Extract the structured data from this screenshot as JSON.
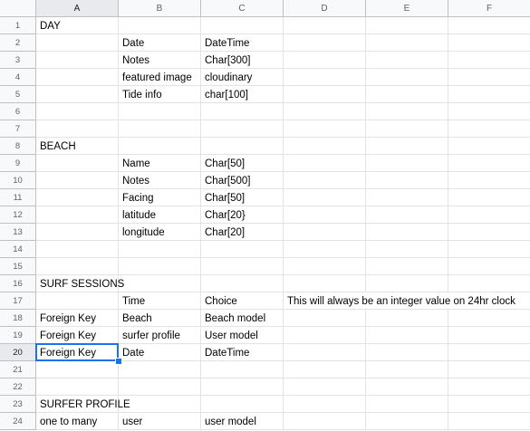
{
  "columns": [
    "A",
    "B",
    "C",
    "D",
    "E",
    "F"
  ],
  "selected_cell": "A20",
  "rows": [
    {
      "num": "1",
      "cells": [
        "DAY",
        "",
        ""
      ]
    },
    {
      "num": "2",
      "cells": [
        "",
        "Date",
        "DateTime"
      ]
    },
    {
      "num": "3",
      "cells": [
        "",
        "Notes",
        "Char[300]"
      ]
    },
    {
      "num": "4",
      "cells": [
        "",
        "featured image",
        "cloudinary"
      ]
    },
    {
      "num": "5",
      "cells": [
        "",
        "Tide info",
        "char[100]"
      ]
    },
    {
      "num": "6",
      "cells": [
        "",
        "",
        ""
      ]
    },
    {
      "num": "7",
      "cells": [
        "",
        "",
        ""
      ]
    },
    {
      "num": "8",
      "cells": [
        "BEACH",
        "",
        ""
      ]
    },
    {
      "num": "9",
      "cells": [
        "",
        "Name",
        "Char[50]"
      ]
    },
    {
      "num": "10",
      "cells": [
        "",
        "Notes",
        "Char[500]"
      ]
    },
    {
      "num": "11",
      "cells": [
        "",
        "Facing",
        "Char[50]"
      ]
    },
    {
      "num": "12",
      "cells": [
        "",
        "latitude",
        "Char[20}"
      ]
    },
    {
      "num": "13",
      "cells": [
        "",
        "longitude",
        "Char[20]"
      ]
    },
    {
      "num": "14",
      "cells": [
        "",
        "",
        ""
      ]
    },
    {
      "num": "15",
      "cells": [
        "",
        "",
        ""
      ]
    },
    {
      "num": "16",
      "cells": [
        "SURF SESSIONS",
        "",
        ""
      ]
    },
    {
      "num": "17",
      "cells": [
        "",
        "Time",
        "Choice",
        "This will always be an integer value on 24hr clock"
      ]
    },
    {
      "num": "18",
      "cells": [
        "Foreign Key",
        "Beach",
        "Beach model"
      ]
    },
    {
      "num": "19",
      "cells": [
        "Foreign Key",
        "surfer profile",
        "User model"
      ]
    },
    {
      "num": "20",
      "cells": [
        "Foreign Key",
        "Date",
        "DateTime"
      ]
    },
    {
      "num": "21",
      "cells": [
        "",
        "",
        ""
      ]
    },
    {
      "num": "22",
      "cells": [
        "",
        "",
        ""
      ]
    },
    {
      "num": "23",
      "cells": [
        "SURFER PROFILE",
        "",
        ""
      ]
    },
    {
      "num": "24",
      "cells": [
        "one to many",
        "user",
        "user model"
      ]
    }
  ]
}
